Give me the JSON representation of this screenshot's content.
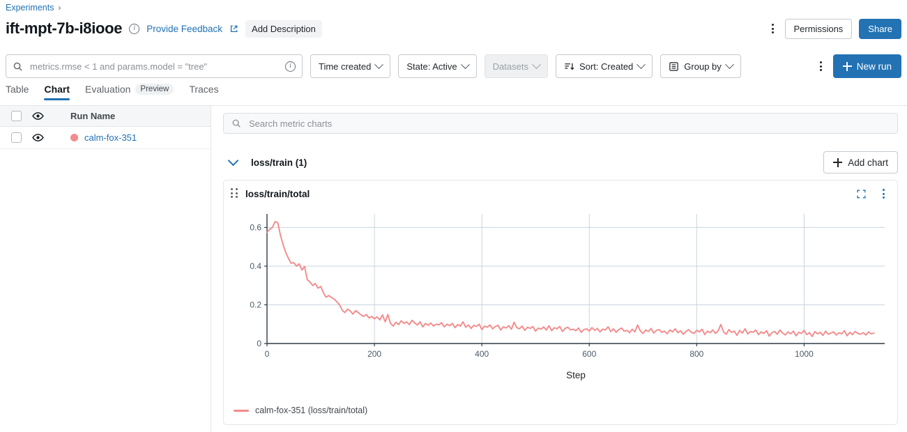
{
  "breadcrumb": {
    "root": "Experiments",
    "separator": "›"
  },
  "header": {
    "title": "ift-mpt-7b-i8iooe",
    "info_icon": "info-circle-icon",
    "feedback_label": "Provide Feedback",
    "external_link_icon": "external-link-icon",
    "add_description_label": "Add Description",
    "overflow_icon": "kebab-menu-icon",
    "permissions_label": "Permissions",
    "share_label": "Share"
  },
  "toolbar": {
    "search_placeholder": "metrics.rmse < 1 and params.model = \"tree\"",
    "search_value": "",
    "search_icon": "search-icon",
    "search_info_icon": "info-circle-icon",
    "time_created_label": "Time created",
    "state_label": "State: Active",
    "datasets_label": "Datasets",
    "sort_label": "Sort: Created",
    "sort_icon": "sort-descending-icon",
    "group_by_label": "Group by",
    "group_by_icon": "list-icon",
    "overflow_icon": "kebab-menu-icon",
    "new_run_label": "New run",
    "new_run_icon": "plus-icon"
  },
  "tabs": [
    {
      "label": "Table",
      "active": false,
      "badge": ""
    },
    {
      "label": "Chart",
      "active": true,
      "badge": ""
    },
    {
      "label": "Evaluation",
      "active": false,
      "badge": "Preview"
    },
    {
      "label": "Traces",
      "active": false,
      "badge": ""
    }
  ],
  "runs_panel": {
    "column_header": "Run Name",
    "header_visibility_icon": "eye-icon",
    "select_all_checkbox": "checkbox-unchecked",
    "rows": [
      {
        "name": "calm-fox-351",
        "color": "#f48a8a",
        "checkbox": "checkbox-unchecked",
        "visibility_icon": "eye-icon"
      }
    ]
  },
  "chart_panel": {
    "search_placeholder": "Search metric charts",
    "search_icon": "search-icon",
    "section_title": "loss/train (1)",
    "collapse_icon": "chevron-down-icon",
    "add_chart_label": "Add chart",
    "add_chart_icon": "plus-icon",
    "card": {
      "drag_handle_icon": "drag-grip-icon",
      "title": "loss/train/total",
      "fullscreen_icon": "fullscreen-icon",
      "overflow_icon": "kebab-menu-icon"
    }
  },
  "colors": {
    "accent_blue": "#2272b4",
    "series_pink": "#f48a8a",
    "grid": "#c9d4de",
    "axis": "#2e3b47",
    "tick_text": "#4b5a68"
  },
  "chart_data": {
    "type": "line",
    "title": "loss/train/total",
    "xlabel": "Step",
    "ylabel": "",
    "xlim": [
      0,
      1150
    ],
    "ylim": [
      0,
      0.67
    ],
    "xticks": [
      0,
      200,
      400,
      600,
      800,
      1000
    ],
    "yticks": [
      0,
      0.2,
      0.4,
      0.6
    ],
    "ytick_labels": [
      "0",
      "0.2",
      "0.4",
      "0.6"
    ],
    "grid": true,
    "grid_axis": "both",
    "legend_position": "bottom-left",
    "legend": [
      "calm-fox-351 (loss/train/total)"
    ],
    "series": [
      {
        "name": "calm-fox-351 (loss/train/total)",
        "color": "#f48a8a",
        "x": [
          0,
          5,
          10,
          15,
          20,
          25,
          30,
          35,
          40,
          45,
          50,
          55,
          60,
          65,
          70,
          75,
          80,
          85,
          90,
          95,
          100,
          105,
          110,
          115,
          120,
          125,
          130,
          135,
          140,
          145,
          150,
          155,
          160,
          165,
          170,
          175,
          180,
          185,
          190,
          195,
          200,
          205,
          210,
          215,
          220,
          225,
          230,
          235,
          240,
          245,
          250,
          255,
          260,
          265,
          270,
          275,
          280,
          285,
          290,
          295,
          300,
          305,
          310,
          315,
          320,
          325,
          330,
          335,
          340,
          345,
          350,
          355,
          360,
          365,
          370,
          375,
          380,
          385,
          390,
          395,
          400,
          405,
          410,
          415,
          420,
          425,
          430,
          435,
          440,
          445,
          450,
          455,
          460,
          465,
          470,
          475,
          480,
          485,
          490,
          495,
          500,
          505,
          510,
          515,
          520,
          525,
          530,
          535,
          540,
          545,
          550,
          555,
          560,
          565,
          570,
          575,
          580,
          585,
          590,
          595,
          600,
          605,
          610,
          615,
          620,
          625,
          630,
          635,
          640,
          645,
          650,
          655,
          660,
          665,
          670,
          675,
          680,
          685,
          690,
          695,
          700,
          705,
          710,
          715,
          720,
          725,
          730,
          735,
          740,
          745,
          750,
          755,
          760,
          765,
          770,
          775,
          780,
          785,
          790,
          795,
          800,
          805,
          810,
          815,
          820,
          825,
          830,
          835,
          840,
          845,
          850,
          855,
          860,
          865,
          870,
          875,
          880,
          885,
          890,
          895,
          900,
          905,
          910,
          915,
          920,
          925,
          930,
          935,
          940,
          945,
          950,
          955,
          960,
          965,
          970,
          975,
          980,
          985,
          990,
          995,
          1000,
          1005,
          1010,
          1015,
          1020,
          1025,
          1030,
          1035,
          1040,
          1045,
          1050,
          1055,
          1060,
          1065,
          1070,
          1075,
          1080,
          1085,
          1090,
          1095,
          1100,
          1105,
          1110,
          1115,
          1120,
          1125,
          1130,
          1135,
          1140,
          1145,
          1150
        ],
        "y": [
          0.575,
          0.59,
          0.6,
          0.63,
          0.625,
          0.56,
          0.51,
          0.47,
          0.44,
          0.415,
          0.418,
          0.4,
          0.412,
          0.38,
          0.398,
          0.33,
          0.318,
          0.3,
          0.31,
          0.286,
          0.295,
          0.262,
          0.24,
          0.248,
          0.238,
          0.23,
          0.216,
          0.2,
          0.172,
          0.16,
          0.178,
          0.168,
          0.152,
          0.17,
          0.16,
          0.148,
          0.14,
          0.15,
          0.132,
          0.14,
          0.128,
          0.138,
          0.122,
          0.148,
          0.112,
          0.15,
          0.104,
          0.09,
          0.11,
          0.098,
          0.118,
          0.104,
          0.112,
          0.098,
          0.12,
          0.106,
          0.096,
          0.112,
          0.086,
          0.104,
          0.094,
          0.106,
          0.09,
          0.1,
          0.096,
          0.108,
          0.086,
          0.1,
          0.092,
          0.104,
          0.082,
          0.098,
          0.09,
          0.112,
          0.084,
          0.096,
          0.078,
          0.094,
          0.088,
          0.1,
          0.072,
          0.09,
          0.084,
          0.096,
          0.076,
          0.088,
          0.094,
          0.07,
          0.086,
          0.08,
          0.092,
          0.074,
          0.11,
          0.082,
          0.076,
          0.09,
          0.068,
          0.084,
          0.078,
          0.088,
          0.064,
          0.08,
          0.074,
          0.086,
          0.07,
          0.092,
          0.066,
          0.082,
          0.076,
          0.088,
          0.062,
          0.078,
          0.084,
          0.07,
          0.074,
          0.066,
          0.08,
          0.058,
          0.072,
          0.076,
          0.064,
          0.082,
          0.068,
          0.078,
          0.06,
          0.074,
          0.07,
          0.086,
          0.062,
          0.076,
          0.058,
          0.072,
          0.08,
          0.064,
          0.068,
          0.056,
          0.074,
          0.06,
          0.096,
          0.066,
          0.052,
          0.07,
          0.062,
          0.078,
          0.054,
          0.068,
          0.072,
          0.058,
          0.064,
          0.05,
          0.07,
          0.06,
          0.076,
          0.056,
          0.066,
          0.048,
          0.062,
          0.072,
          0.058,
          0.052,
          0.068,
          0.06,
          0.074,
          0.046,
          0.064,
          0.056,
          0.07,
          0.052,
          0.066,
          0.098,
          0.06,
          0.048,
          0.072,
          0.058,
          0.064,
          0.042,
          0.068,
          0.054,
          0.076,
          0.05,
          0.062,
          0.058,
          0.07,
          0.046,
          0.06,
          0.052,
          0.066,
          0.038,
          0.056,
          0.062,
          0.048,
          0.07,
          0.054,
          0.044,
          0.06,
          0.05,
          0.064,
          0.04,
          0.058,
          0.052,
          0.068,
          0.046,
          0.056,
          0.036,
          0.062,
          0.05,
          0.058,
          0.042,
          0.064,
          0.048,
          0.054,
          0.06,
          0.044,
          0.056,
          0.05,
          0.066,
          0.04,
          0.058,
          0.046,
          0.062,
          0.052,
          0.048,
          0.056,
          0.044,
          0.06,
          0.05,
          0.054
        ]
      }
    ]
  }
}
